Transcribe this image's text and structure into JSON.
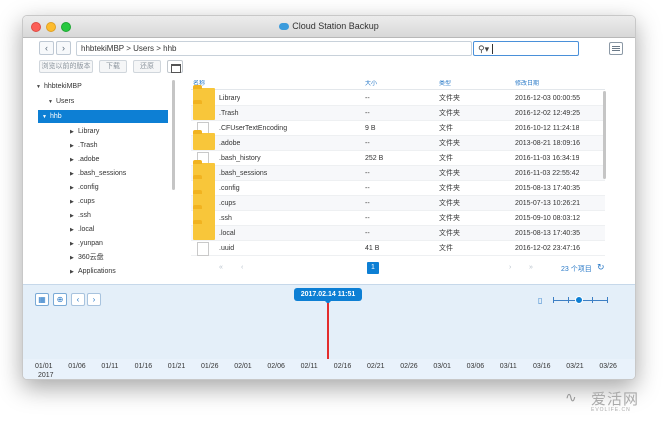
{
  "window": {
    "title": "Cloud Station Backup"
  },
  "toolbar": {
    "back": "‹",
    "forward": "›",
    "path": "hhbtekiMBP > Users > hhb",
    "search_value": "",
    "search_icon": "search-icon"
  },
  "actions": {
    "browse_prev": "浏览以前的版本",
    "download": "下载",
    "restore": "还原"
  },
  "tree": [
    {
      "label": "hhbtekiMBP",
      "expanded": true
    },
    {
      "label": "Users",
      "expanded": true
    },
    {
      "label": "hhb",
      "expanded": true,
      "selected": true
    },
    {
      "label": "Library"
    },
    {
      "label": ".Trash"
    },
    {
      "label": ".adobe"
    },
    {
      "label": ".bash_sessions"
    },
    {
      "label": ".config"
    },
    {
      "label": ".cups"
    },
    {
      "label": ".ssh"
    },
    {
      "label": ".local"
    },
    {
      "label": ".yunpan"
    },
    {
      "label": "360云盘"
    },
    {
      "label": "Applications"
    }
  ],
  "files": {
    "headers": {
      "name": "名称",
      "size": "大小",
      "type": "类型",
      "modified": "修改日期"
    },
    "rows": [
      {
        "name": "Library",
        "size": "--",
        "type": "文件夹",
        "modified": "2016-12-03 00:00:55",
        "icon": "folder"
      },
      {
        "name": ".Trash",
        "size": "--",
        "type": "文件夹",
        "modified": "2016-12-02 12:49:25",
        "icon": "folder"
      },
      {
        "name": ".CFUserTextEncoding",
        "size": "9 B",
        "type": "文件",
        "modified": "2016-10-12 11:24:18",
        "icon": "file"
      },
      {
        "name": ".adobe",
        "size": "--",
        "type": "文件夹",
        "modified": "2013-08-21 18:09:16",
        "icon": "folder"
      },
      {
        "name": ".bash_history",
        "size": "252 B",
        "type": "文件",
        "modified": "2016-11-03 16:34:19",
        "icon": "file"
      },
      {
        "name": ".bash_sessions",
        "size": "--",
        "type": "文件夹",
        "modified": "2016-11-03 22:55:42",
        "icon": "folder"
      },
      {
        "name": ".config",
        "size": "--",
        "type": "文件夹",
        "modified": "2015-08-13 17:40:35",
        "icon": "folder"
      },
      {
        "name": ".cups",
        "size": "--",
        "type": "文件夹",
        "modified": "2015-07-13 10:26:21",
        "icon": "folder"
      },
      {
        "name": ".ssh",
        "size": "--",
        "type": "文件夹",
        "modified": "2015-09-10 08:03:12",
        "icon": "folder"
      },
      {
        "name": ".local",
        "size": "--",
        "type": "文件夹",
        "modified": "2015-08-13 17:40:35",
        "icon": "folder"
      },
      {
        "name": ".uuid",
        "size": "41 B",
        "type": "文件",
        "modified": "2016-12-02 23:47:16",
        "icon": "file"
      }
    ]
  },
  "pager": {
    "first": "«",
    "prev": "‹",
    "current": "1",
    "next": "›",
    "last": "»",
    "count": "23 个项目",
    "refresh": "↻"
  },
  "timeline": {
    "current": "2017.02.14 11:51",
    "year": "2017",
    "labels": [
      "01/01",
      "01/06",
      "01/11",
      "01/16",
      "01/21",
      "01/26",
      "02/01",
      "02/06",
      "02/11",
      "02/16",
      "02/21",
      "02/26",
      "03/01",
      "03/06",
      "03/11",
      "03/16",
      "03/21",
      "03/26"
    ],
    "prev": "‹",
    "next": "›",
    "calendar_icon": "calendar-icon",
    "locate_icon": "crosshair-icon",
    "zoom_icon": "zoom-icon"
  },
  "watermark": {
    "text": "爱活网",
    "sub": "EVOLIFE.CN"
  },
  "colors": {
    "accent": "#0d7fd4",
    "folder": "#f8c63a",
    "marker": "#e32d2d"
  }
}
